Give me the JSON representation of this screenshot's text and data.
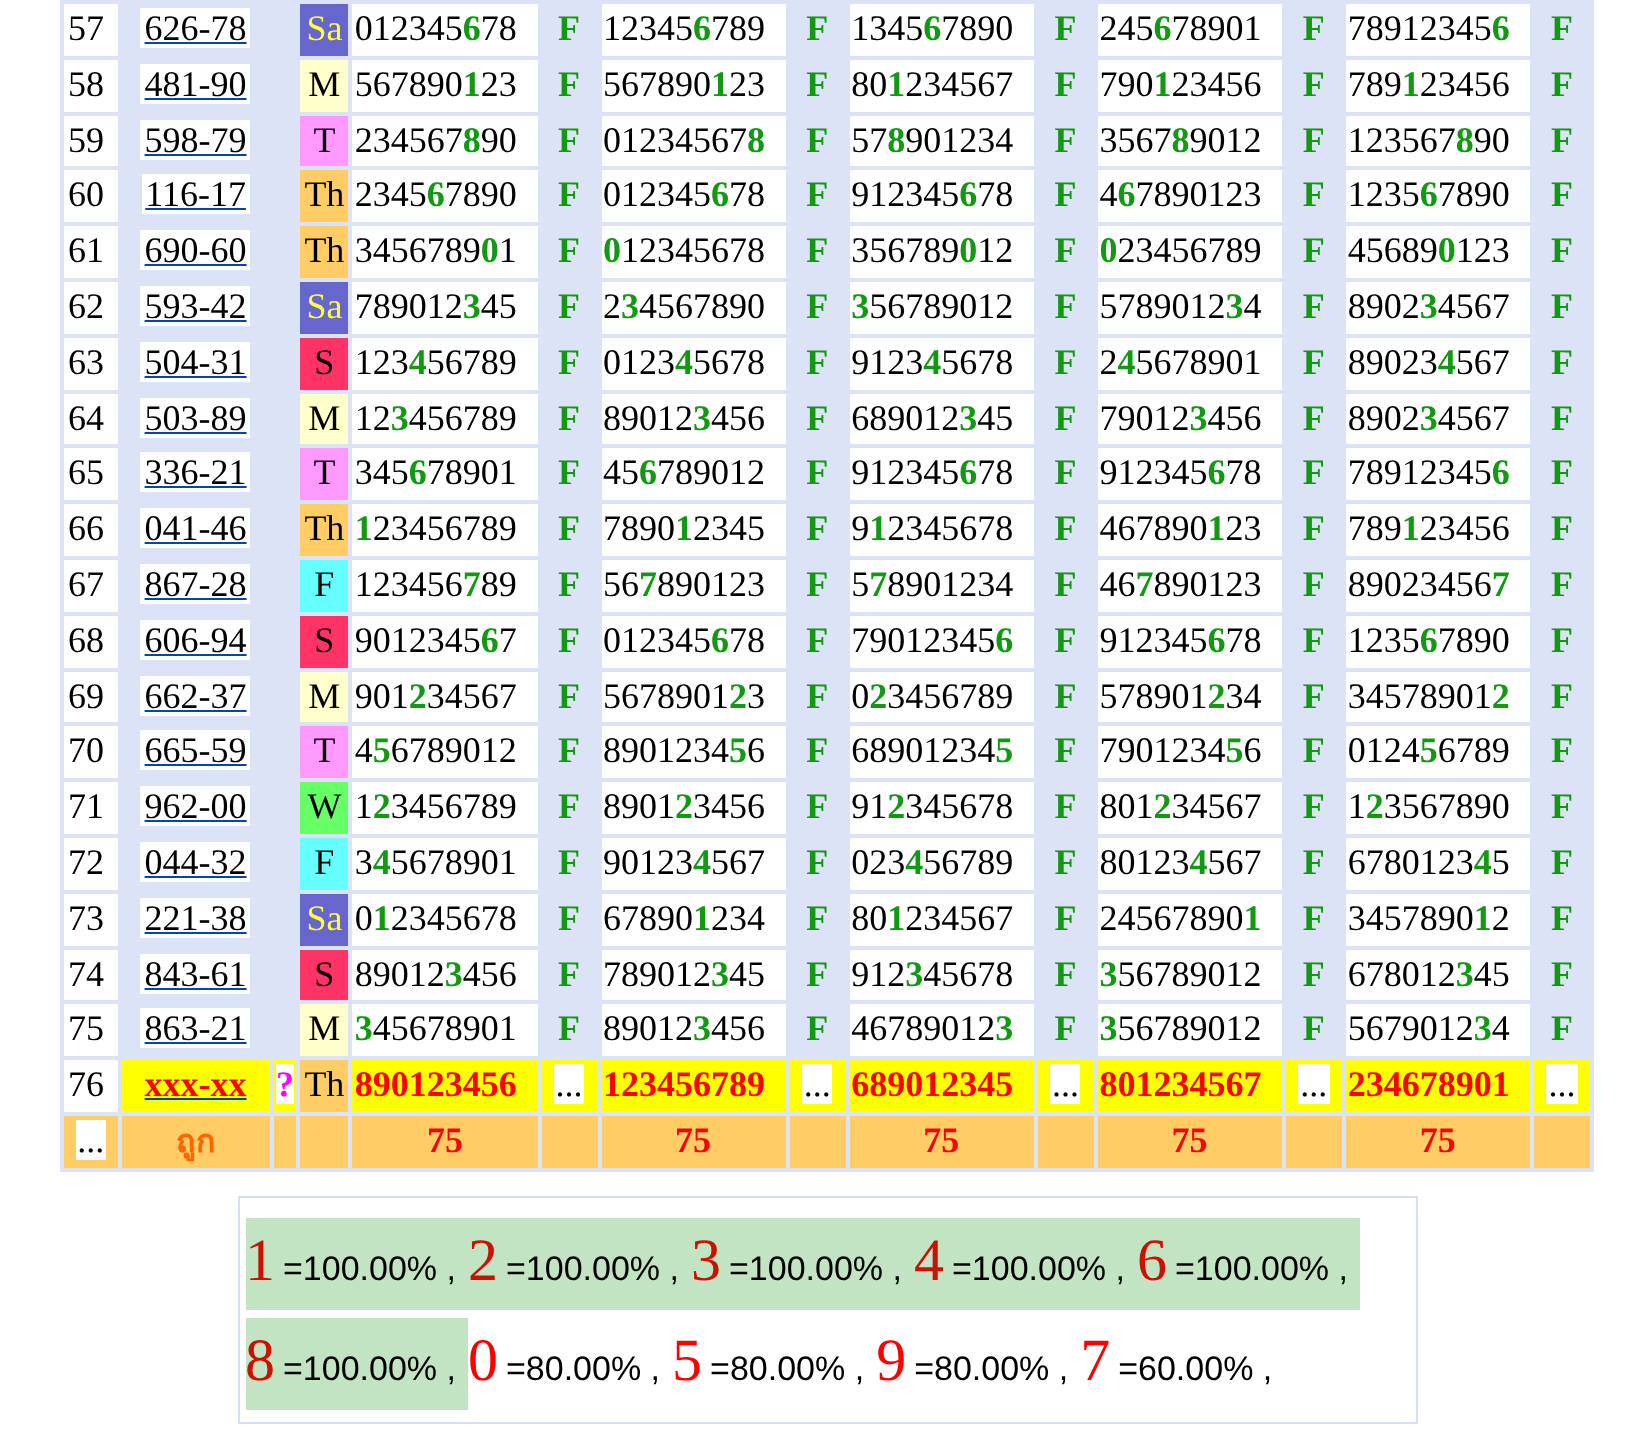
{
  "rows": [
    {
      "no": "57",
      "code": "626-78",
      "day": {
        "label": "Sa",
        "color": "#6666cc"
      },
      "cells": [
        {
          "number": "012345**6**78",
          "mark": "F"
        },
        {
          "number": "12345**6**789",
          "mark": "F"
        },
        {
          "number": "1345**6**7890",
          "mark": "F"
        },
        {
          "number": "245**6**78901",
          "mark": "F"
        },
        {
          "number": "78912345**6**",
          "mark": "F"
        }
      ]
    },
    {
      "no": "58",
      "code": "481-90",
      "day": {
        "label": "M",
        "color": "#ffffcc"
      },
      "cells": [
        {
          "number": "567890**1**23",
          "mark": "F"
        },
        {
          "number": "567890**1**23",
          "mark": "F"
        },
        {
          "number": "80**1**234567",
          "mark": "F"
        },
        {
          "number": "790**1**23456",
          "mark": "F"
        },
        {
          "number": "789**1**23456",
          "mark": "F"
        }
      ]
    },
    {
      "no": "59",
      "code": "598-79",
      "day": {
        "label": "T",
        "color": "#ff99ff"
      },
      "cells": [
        {
          "number": "234567**8**90",
          "mark": "F"
        },
        {
          "number": "01234567**8**",
          "mark": "F"
        },
        {
          "number": "57**8**901234",
          "mark": "F"
        },
        {
          "number": "3567**8**9012",
          "mark": "F"
        },
        {
          "number": "123567**8**90",
          "mark": "F"
        }
      ]
    },
    {
      "no": "60",
      "code": "116-17",
      "day": {
        "label": "Th",
        "color": "#ffcc66"
      },
      "cells": [
        {
          "number": "2345**6**7890",
          "mark": "F"
        },
        {
          "number": "012345**6**78",
          "mark": "F"
        },
        {
          "number": "912345**6**78",
          "mark": "F"
        },
        {
          "number": "4**6**7890123",
          "mark": "F"
        },
        {
          "number": "1235**6**7890",
          "mark": "F"
        }
      ]
    },
    {
      "no": "61",
      "code": "690-60",
      "day": {
        "label": "Th",
        "color": "#ffcc66"
      },
      "cells": [
        {
          "number": "3456789**0**1",
          "mark": "F"
        },
        {
          "number": "**0**12345678",
          "mark": "F"
        },
        {
          "number": "356789**0**12",
          "mark": "F"
        },
        {
          "number": "**0**23456789",
          "mark": "F"
        },
        {
          "number": "45689**0**123",
          "mark": "F"
        }
      ]
    },
    {
      "no": "62",
      "code": "593-42",
      "day": {
        "label": "Sa",
        "color": "#6666cc"
      },
      "cells": [
        {
          "number": "789012**3**45",
          "mark": "F"
        },
        {
          "number": "2**3**4567890",
          "mark": "F"
        },
        {
          "number": "**3**56789012",
          "mark": "F"
        },
        {
          "number": "5789012**3**4",
          "mark": "F"
        },
        {
          "number": "8902**3**4567",
          "mark": "F"
        }
      ]
    },
    {
      "no": "63",
      "code": "504-31",
      "day": {
        "label": "S",
        "color": "#ff3366"
      },
      "cells": [
        {
          "number": "123**4**56789",
          "mark": "F"
        },
        {
          "number": "0123**4**5678",
          "mark": "F"
        },
        {
          "number": "9123**4**5678",
          "mark": "F"
        },
        {
          "number": "2**4**5678901",
          "mark": "F"
        },
        {
          "number": "89023**4**567",
          "mark": "F"
        }
      ]
    },
    {
      "no": "64",
      "code": "503-89",
      "day": {
        "label": "M",
        "color": "#ffffcc"
      },
      "cells": [
        {
          "number": "12**3**456789",
          "mark": "F"
        },
        {
          "number": "89012**3**456",
          "mark": "F"
        },
        {
          "number": "689012**3**45",
          "mark": "F"
        },
        {
          "number": "79012**3**456",
          "mark": "F"
        },
        {
          "number": "8902**3**4567",
          "mark": "F"
        }
      ]
    },
    {
      "no": "65",
      "code": "336-21",
      "day": {
        "label": "T",
        "color": "#ff99ff"
      },
      "cells": [
        {
          "number": "345**6**78901",
          "mark": "F"
        },
        {
          "number": "45**6**789012",
          "mark": "F"
        },
        {
          "number": "912345**6**78",
          "mark": "F"
        },
        {
          "number": "912345**6**78",
          "mark": "F"
        },
        {
          "number": "78912345**6**",
          "mark": "F"
        }
      ]
    },
    {
      "no": "66",
      "code": "041-46",
      "day": {
        "label": "Th",
        "color": "#ffcc66"
      },
      "cells": [
        {
          "number": "**1**23456789",
          "mark": "F"
        },
        {
          "number": "7890**1**2345",
          "mark": "F"
        },
        {
          "number": "9**1**2345678",
          "mark": "F"
        },
        {
          "number": "467890**1**23",
          "mark": "F"
        },
        {
          "number": "789**1**23456",
          "mark": "F"
        }
      ]
    },
    {
      "no": "67",
      "code": "867-28",
      "day": {
        "label": "F",
        "color": "#66ffff"
      },
      "cells": [
        {
          "number": "123456**7**89",
          "mark": "F"
        },
        {
          "number": "56**7**890123",
          "mark": "F"
        },
        {
          "number": "5**7**8901234",
          "mark": "F"
        },
        {
          "number": "46**7**890123",
          "mark": "F"
        },
        {
          "number": "89023456**7**",
          "mark": "F"
        }
      ]
    },
    {
      "no": "68",
      "code": "606-94",
      "day": {
        "label": "S",
        "color": "#ff3366"
      },
      "cells": [
        {
          "number": "9012345**6**7",
          "mark": "F"
        },
        {
          "number": "012345**6**78",
          "mark": "F"
        },
        {
          "number": "79012345**6**",
          "mark": "F"
        },
        {
          "number": "912345**6**78",
          "mark": "F"
        },
        {
          "number": "1235**6**7890",
          "mark": "F"
        }
      ]
    },
    {
      "no": "69",
      "code": "662-37",
      "day": {
        "label": "M",
        "color": "#ffffcc"
      },
      "cells": [
        {
          "number": "901**2**34567",
          "mark": "F"
        },
        {
          "number": "5678901**2**3",
          "mark": "F"
        },
        {
          "number": "0**2**3456789",
          "mark": "F"
        },
        {
          "number": "578901**2**34",
          "mark": "F"
        },
        {
          "number": "34578901**2**",
          "mark": "F"
        }
      ]
    },
    {
      "no": "70",
      "code": "665-59",
      "day": {
        "label": "T",
        "color": "#ff99ff"
      },
      "cells": [
        {
          "number": "4**5**6789012",
          "mark": "F"
        },
        {
          "number": "8901234**5**6",
          "mark": "F"
        },
        {
          "number": "68901234**5**",
          "mark": "F"
        },
        {
          "number": "7901234**5**6",
          "mark": "F"
        },
        {
          "number": "0124**5**6789",
          "mark": "F"
        }
      ]
    },
    {
      "no": "71",
      "code": "962-00",
      "day": {
        "label": "W",
        "color": "#66ff66"
      },
      "cells": [
        {
          "number": "1**2**3456789",
          "mark": "F"
        },
        {
          "number": "8901**2**3456",
          "mark": "F"
        },
        {
          "number": "91**2**345678",
          "mark": "F"
        },
        {
          "number": "801**2**34567",
          "mark": "F"
        },
        {
          "number": "1**2**3567890",
          "mark": "F"
        }
      ]
    },
    {
      "no": "72",
      "code": "044-32",
      "day": {
        "label": "F",
        "color": "#66ffff"
      },
      "cells": [
        {
          "number": "3**4**5678901",
          "mark": "F"
        },
        {
          "number": "90123**4**567",
          "mark": "F"
        },
        {
          "number": "023**4**56789",
          "mark": "F"
        },
        {
          "number": "80123**4**567",
          "mark": "F"
        },
        {
          "number": "6780123**4**5",
          "mark": "F"
        }
      ]
    },
    {
      "no": "73",
      "code": "221-38",
      "day": {
        "label": "Sa",
        "color": "#6666cc"
      },
      "cells": [
        {
          "number": "0**1**2345678",
          "mark": "F"
        },
        {
          "number": "67890**1**234",
          "mark": "F"
        },
        {
          "number": "80**1**234567",
          "mark": "F"
        },
        {
          "number": "24567890**1**",
          "mark": "F"
        },
        {
          "number": "3457890**1**2",
          "mark": "F"
        }
      ]
    },
    {
      "no": "74",
      "code": "843-61",
      "day": {
        "label": "S",
        "color": "#ff3366"
      },
      "cells": [
        {
          "number": "89012**3**456",
          "mark": "F"
        },
        {
          "number": "789012**3**45",
          "mark": "F"
        },
        {
          "number": "912**3**45678",
          "mark": "F"
        },
        {
          "number": "**3**56789012",
          "mark": "F"
        },
        {
          "number": "678012**3**45",
          "mark": "F"
        }
      ]
    },
    {
      "no": "75",
      "code": "863-21",
      "day": {
        "label": "M",
        "color": "#ffffcc"
      },
      "cells": [
        {
          "number": "**3**45678901",
          "mark": "F"
        },
        {
          "number": "89012**3**456",
          "mark": "F"
        },
        {
          "number": "46789012**3**",
          "mark": "F"
        },
        {
          "number": "**3**56789012",
          "mark": "F"
        },
        {
          "number": "5679012**3**4",
          "mark": "F"
        }
      ]
    }
  ],
  "pending_row": {
    "no": "76",
    "code": "xxx-xx",
    "flag": "?",
    "day": {
      "label": "Th",
      "color": "#ffcc66"
    },
    "cells": [
      {
        "number": "890123456",
        "mark": "..."
      },
      {
        "number": "123456789",
        "mark": "..."
      },
      {
        "number": "689012345",
        "mark": "..."
      },
      {
        "number": "801234567",
        "mark": "..."
      },
      {
        "number": "234678901",
        "mark": "..."
      }
    ]
  },
  "summary_row": {
    "no": "...",
    "label": "ถูก",
    "counts": [
      "75",
      "75",
      "75",
      "75",
      "75"
    ]
  },
  "stats": [
    {
      "digit": "1",
      "percent": "=100.00% ,",
      "highlighted": true
    },
    {
      "digit": "2",
      "percent": "=100.00% ,",
      "highlighted": true
    },
    {
      "digit": "3",
      "percent": "=100.00% ,",
      "highlighted": true
    },
    {
      "digit": "4",
      "percent": "=100.00% ,",
      "highlighted": true
    },
    {
      "digit": "6",
      "percent": "=100.00% ,",
      "highlighted": true
    },
    {
      "digit": "8",
      "percent": "=100.00% ,",
      "highlighted": true
    },
    {
      "digit": "0",
      "percent": "=80.00% ,",
      "highlighted": false
    },
    {
      "digit": "5",
      "percent": "=80.00% ,",
      "highlighted": false
    },
    {
      "digit": "9",
      "percent": "=80.00% ,",
      "highlighted": false
    },
    {
      "digit": "7",
      "percent": "=60.00% ,",
      "highlighted": false
    }
  ]
}
